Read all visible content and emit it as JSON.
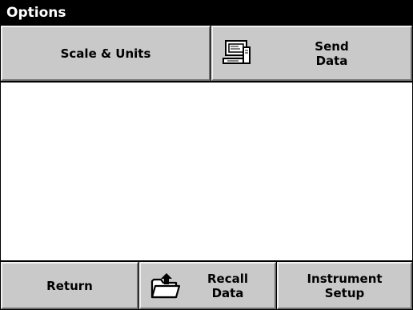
{
  "title": "Options",
  "top_buttons": {
    "scale_units": "Scale & Units",
    "send_data": "Send\nData"
  },
  "bottom_buttons": {
    "return": "Return",
    "recall_data": "Recall\nData",
    "instrument_setup": "Instrument\nSetup"
  },
  "icons": {
    "send_data": "computer-icon",
    "recall_data": "folder-upload-icon"
  }
}
